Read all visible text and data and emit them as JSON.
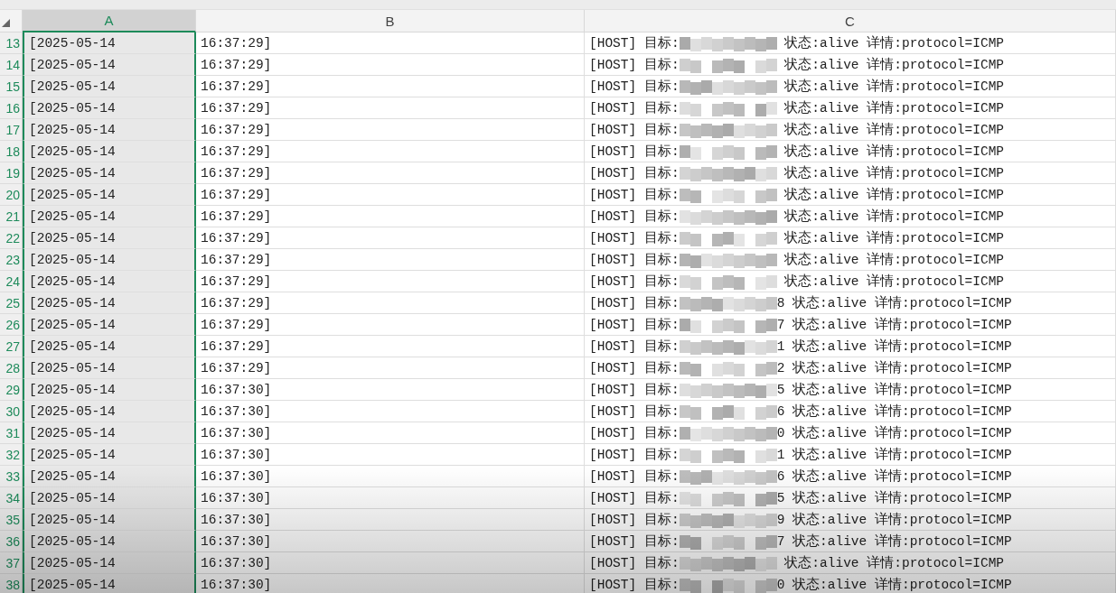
{
  "columns": [
    {
      "label": "A",
      "selected": true
    },
    {
      "label": "B",
      "selected": false
    },
    {
      "label": "C",
      "selected": false
    }
  ],
  "rows": [
    {
      "number": "13",
      "a": "[2025-05-14",
      "b": "16:37:29]",
      "c_prefix": "[HOST] 目标:",
      "c_suffix": " 状态:alive 详情:protocol=ICMP"
    },
    {
      "number": "14",
      "a": "[2025-05-14",
      "b": "16:37:29]",
      "c_prefix": "[HOST] 目标:",
      "c_suffix": " 状态:alive 详情:protocol=ICMP"
    },
    {
      "number": "15",
      "a": "[2025-05-14",
      "b": "16:37:29]",
      "c_prefix": "[HOST] 目标:",
      "c_suffix": " 状态:alive 详情:protocol=ICMP"
    },
    {
      "number": "16",
      "a": "[2025-05-14",
      "b": "16:37:29]",
      "c_prefix": "[HOST] 目标:",
      "c_suffix": " 状态:alive 详情:protocol=ICMP"
    },
    {
      "number": "17",
      "a": "[2025-05-14",
      "b": "16:37:29]",
      "c_prefix": "[HOST] 目标:",
      "c_suffix": " 状态:alive 详情:protocol=ICMP"
    },
    {
      "number": "18",
      "a": "[2025-05-14",
      "b": "16:37:29]",
      "c_prefix": "[HOST] 目标:",
      "c_suffix": " 状态:alive 详情:protocol=ICMP"
    },
    {
      "number": "19",
      "a": "[2025-05-14",
      "b": "16:37:29]",
      "c_prefix": "[HOST] 目标:",
      "c_suffix": " 状态:alive 详情:protocol=ICMP"
    },
    {
      "number": "20",
      "a": "[2025-05-14",
      "b": "16:37:29]",
      "c_prefix": "[HOST] 目标:",
      "c_suffix": " 状态:alive 详情:protocol=ICMP"
    },
    {
      "number": "21",
      "a": "[2025-05-14",
      "b": "16:37:29]",
      "c_prefix": "[HOST] 目标:",
      "c_suffix": " 状态:alive 详情:protocol=ICMP"
    },
    {
      "number": "22",
      "a": "[2025-05-14",
      "b": "16:37:29]",
      "c_prefix": "[HOST] 目标:",
      "c_suffix": " 状态:alive 详情:protocol=ICMP"
    },
    {
      "number": "23",
      "a": "[2025-05-14",
      "b": "16:37:29]",
      "c_prefix": "[HOST] 目标:",
      "c_suffix": " 状态:alive 详情:protocol=ICMP"
    },
    {
      "number": "24",
      "a": "[2025-05-14",
      "b": "16:37:29]",
      "c_prefix": "[HOST] 目标:",
      "c_suffix": " 状态:alive 详情:protocol=ICMP"
    },
    {
      "number": "25",
      "a": "[2025-05-14",
      "b": "16:37:29]",
      "c_prefix": "[HOST] 目标:",
      "c_suffix": "8 状态:alive 详情:protocol=ICMP"
    },
    {
      "number": "26",
      "a": "[2025-05-14",
      "b": "16:37:29]",
      "c_prefix": "[HOST] 目标:",
      "c_suffix": "7 状态:alive 详情:protocol=ICMP"
    },
    {
      "number": "27",
      "a": "[2025-05-14",
      "b": "16:37:29]",
      "c_prefix": "[HOST] 目标:",
      "c_suffix": "1 状态:alive 详情:protocol=ICMP"
    },
    {
      "number": "28",
      "a": "[2025-05-14",
      "b": "16:37:29]",
      "c_prefix": "[HOST] 目标:",
      "c_suffix": "2 状态:alive 详情:protocol=ICMP"
    },
    {
      "number": "29",
      "a": "[2025-05-14",
      "b": "16:37:30]",
      "c_prefix": "[HOST] 目标:",
      "c_suffix": "5 状态:alive 详情:protocol=ICMP"
    },
    {
      "number": "30",
      "a": "[2025-05-14",
      "b": "16:37:30]",
      "c_prefix": "[HOST] 目标:",
      "c_suffix": "6 状态:alive 详情:protocol=ICMP"
    },
    {
      "number": "31",
      "a": "[2025-05-14",
      "b": "16:37:30]",
      "c_prefix": "[HOST] 目标:",
      "c_suffix": "0 状态:alive 详情:protocol=ICMP"
    },
    {
      "number": "32",
      "a": "[2025-05-14",
      "b": "16:37:30]",
      "c_prefix": "[HOST] 目标:",
      "c_suffix": "1 状态:alive 详情:protocol=ICMP"
    },
    {
      "number": "33",
      "a": "[2025-05-14",
      "b": "16:37:30]",
      "c_prefix": "[HOST] 目标:",
      "c_suffix": "6 状态:alive 详情:protocol=ICMP"
    },
    {
      "number": "34",
      "a": "[2025-05-14",
      "b": "16:37:30]",
      "c_prefix": "[HOST] 目标:",
      "c_suffix": "5 状态:alive 详情:protocol=ICMP"
    },
    {
      "number": "35",
      "a": "[2025-05-14",
      "b": "16:37:30]",
      "c_prefix": "[HOST] 目标:",
      "c_suffix": "9 状态:alive 详情:protocol=ICMP"
    },
    {
      "number": "36",
      "a": "[2025-05-14",
      "b": "16:37:30]",
      "c_prefix": "[HOST] 目标:",
      "c_suffix": "7 状态:alive 详情:protocol=ICMP"
    },
    {
      "number": "37",
      "a": "[2025-05-14",
      "b": "16:37:30]",
      "c_prefix": "[HOST] 目标:",
      "c_suffix": " 状态:alive 详情:protocol=ICMP"
    },
    {
      "number": "38",
      "a": "[2025-05-14",
      "b": "16:37:30]",
      "c_prefix": "[HOST] 目标:",
      "c_suffix": "0 状态:alive 详情:protocol=ICMP"
    }
  ]
}
